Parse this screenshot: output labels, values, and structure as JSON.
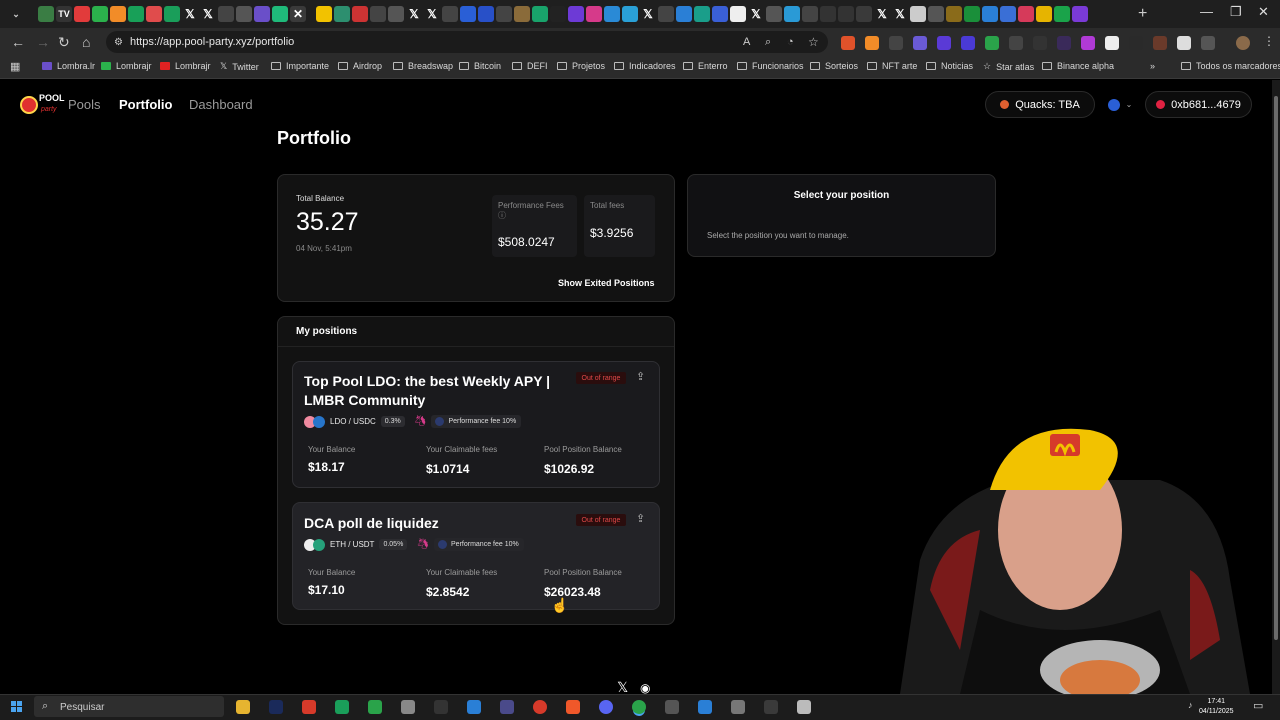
{
  "browser": {
    "url": "https://app.pool-party.xyz/portfolio",
    "bookmarks": [
      "Lombra.lr",
      "Lombrajr",
      "Lombrajr",
      "Twitter",
      "Importante",
      "Airdrop",
      "Breadswap",
      "Bitcoin",
      "DEFI",
      "Projetos",
      "Indicadores",
      "Enterro",
      "Funcionarios",
      "Sorteios",
      "NFT arte",
      "Noticias",
      "Star atlas",
      "Binance alpha"
    ],
    "all_bookmarks": "Todos os marcadores"
  },
  "app": {
    "logo_text": "POOL",
    "logo_sub": "party",
    "nav": [
      "Pools",
      "Portfolio",
      "Dashboard"
    ],
    "quacks": "Quacks: TBA",
    "wallet": "0xb681...4679"
  },
  "page": {
    "title": "Portfolio",
    "summary": {
      "total_balance_label": "Total Balance",
      "total_balance": "35.27",
      "date": "04 Nov, 5:41pm",
      "performance_fees_label": "Performance Fees",
      "performance_fees": "$508.0247",
      "total_fees_label": "Total fees",
      "total_fees": "$3.9256",
      "show_exited": "Show Exited Positions"
    },
    "select_panel": {
      "title": "Select your position",
      "subtitle": "Select the position you want to manage."
    },
    "positions_header": "My positions",
    "positions": [
      {
        "title": "Top Pool LDO: the best Weekly APY | LMBR Community",
        "status": "Out of range",
        "pair": "LDO / USDC",
        "fee": "0.3%",
        "perf_fee": "Performance fee 10%",
        "your_balance_label": "Your Balance",
        "your_balance": "$18.17",
        "claimable_label": "Your Claimable fees",
        "claimable": "$1.0714",
        "pool_balance_label": "Pool Position Balance",
        "pool_balance": "$1026.92"
      },
      {
        "title": "DCA poll de liquidez",
        "status": "Out of range",
        "pair": "ETH / USDT",
        "fee": "0.05%",
        "perf_fee": "Performance fee 10%",
        "your_balance_label": "Your Balance",
        "your_balance": "$17.10",
        "claimable_label": "Your Claimable fees",
        "claimable": "$2.8542",
        "pool_balance_label": "Pool Position Balance",
        "pool_balance": "$26023.48"
      }
    ]
  },
  "taskbar": {
    "search": "Pesquisar",
    "time": "17:41",
    "date": "04/11/2025"
  }
}
